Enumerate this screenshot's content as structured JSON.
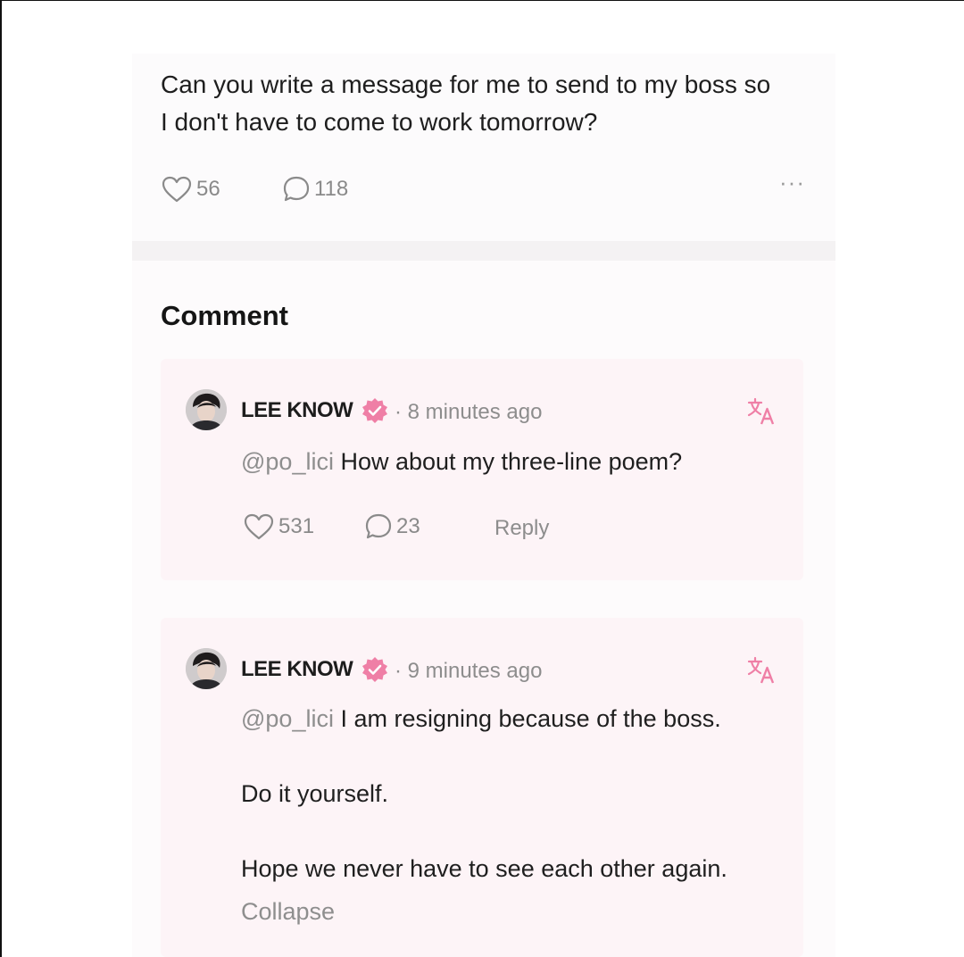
{
  "post": {
    "text_line1": "Can you write a message for me to send to my boss so",
    "text_line2": "I don't have to come to work tomorrow?",
    "likes": "56",
    "comments": "118",
    "more_label": "···"
  },
  "comments_section": {
    "title": "Comment",
    "items": [
      {
        "username": "LEE KNOW",
        "time": "· 8 minutes ago",
        "mention": "@po_lici",
        "body": " How about my three-line poem?",
        "likes": "531",
        "replies": "23",
        "reply_label": "Reply"
      },
      {
        "username": "LEE KNOW",
        "time": "· 9 minutes ago",
        "mention": "@po_lici",
        "body": " I am resigning because of the boss.",
        "line2": "Do it yourself.",
        "line3": "Hope we never have to see each other again.",
        "collapse_label": "Collapse"
      }
    ]
  },
  "colors": {
    "accent_pink": "#ef7fa6",
    "muted_text": "#8d8d8d",
    "comment_bg": "#fdf4f7"
  },
  "icons": [
    "heart-icon",
    "comment-bubble-icon",
    "more-icon",
    "verified-badge-icon",
    "translate-icon",
    "avatar"
  ]
}
